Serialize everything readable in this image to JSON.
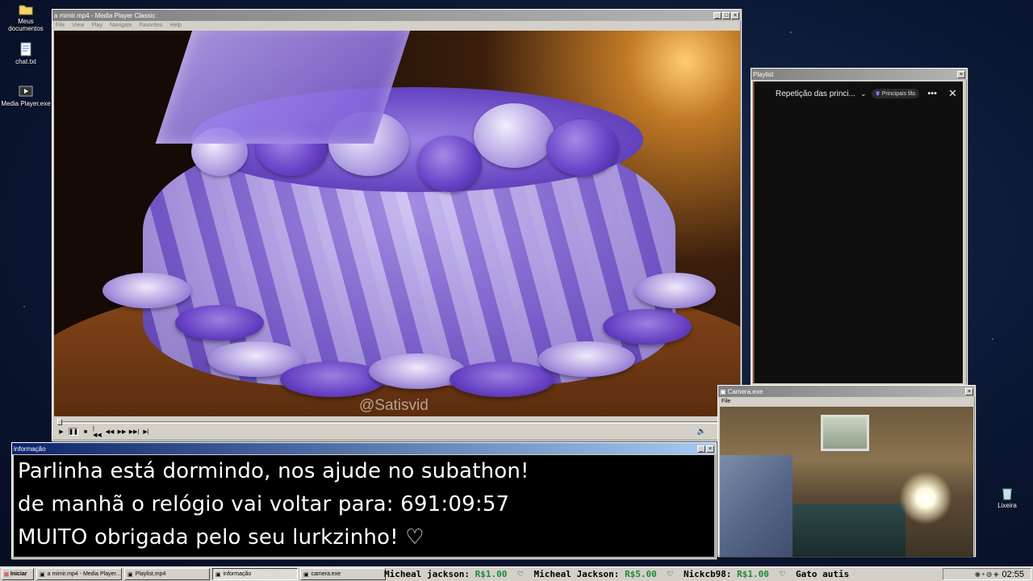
{
  "desktop": {
    "icons": [
      {
        "label": "Meus documentos",
        "icon": "folder-icon"
      },
      {
        "label": "chat.txt",
        "icon": "text-file-icon"
      },
      {
        "label": "Media Player.exe",
        "icon": "media-player-icon"
      },
      {
        "label": "Lixeira",
        "icon": "recycle-bin-icon"
      }
    ]
  },
  "player": {
    "title": "a mimir.mp4 - Media Player Classic",
    "menu": [
      "File",
      "View",
      "Play",
      "Navigate",
      "Favorites",
      "Help"
    ],
    "watermark": "@Satisvid",
    "progress": 0.0
  },
  "playlist": {
    "title": "Playlist",
    "header_title": "Repetição das princi...",
    "badge": "Principais fãs"
  },
  "info": {
    "title": "informação",
    "lines": [
      "Parlinha está dormindo, nos ajude no subathon!",
      "de manhã o relógio vai voltar para:  691:09:57",
      "MUITO obrigada pelo seu lurkzinho! ♡"
    ]
  },
  "camera": {
    "title": "Camera.exe",
    "menu": [
      "File"
    ]
  },
  "taskbar": {
    "start_label": "Iniciar",
    "tasks": [
      {
        "label": "a mimir.mp4 - Media Player...",
        "active": false
      },
      {
        "label": "Playlist.mp4",
        "active": false
      },
      {
        "label": "informação",
        "active": true
      },
      {
        "label": "camera.exe",
        "active": false
      }
    ],
    "ticker": [
      {
        "name": "Micheal jackson:",
        "amount": "R$1.00"
      },
      {
        "name": "Micheal Jackson:",
        "amount": "R$5.00"
      },
      {
        "name": "Nickcb98:",
        "amount": "R$1.00"
      },
      {
        "name": "Gato autis",
        "amount": ""
      }
    ],
    "clock": "02:55"
  },
  "colors": {
    "active_title": "#0a246a",
    "inactive_title": "#808080",
    "ticker_amount": "#1b8a3c"
  }
}
